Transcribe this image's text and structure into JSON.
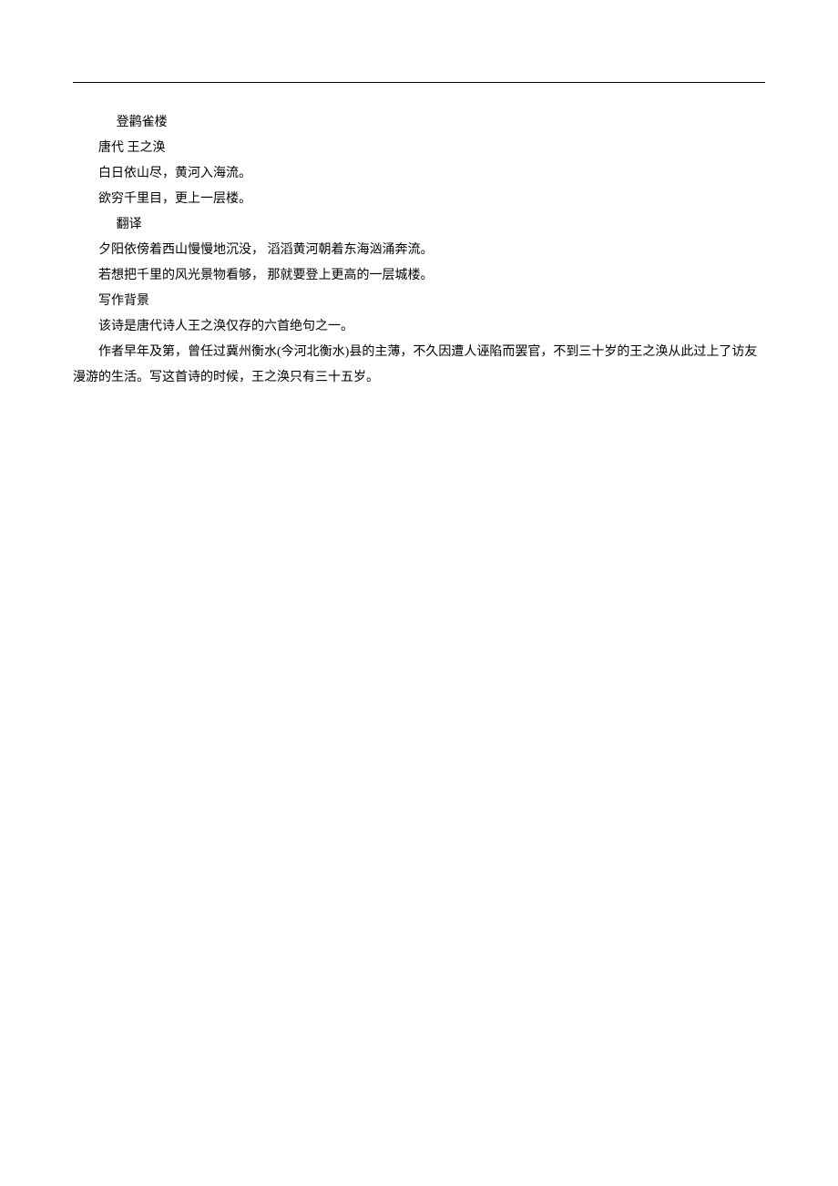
{
  "title": "登鹳雀楼",
  "byline": "唐代  王之涣",
  "poem_line1": "白日依山尽，黄河入海流。",
  "poem_line2": "欲穷千里目，更上一层楼。",
  "section_translation_heading": "翻译",
  "translation_line1": "夕阳依傍着西山慢慢地沉没，    滔滔黄河朝着东海汹涌奔流。",
  "translation_line2": "若想把千里的风光景物看够，    那就要登上更高的一层城楼。",
  "section_background_heading": "写作背景",
  "background_p1": "该诗是唐代诗人王之涣仅存的六首绝句之一。",
  "background_p2": "作者早年及第，曾任过冀州衡水(今河北衡水)县的主薄，不久因遭人诬陷而罢官，不到三十岁的王之涣从此过上了访友漫游的生活。写这首诗的时候，王之涣只有三十五岁。"
}
